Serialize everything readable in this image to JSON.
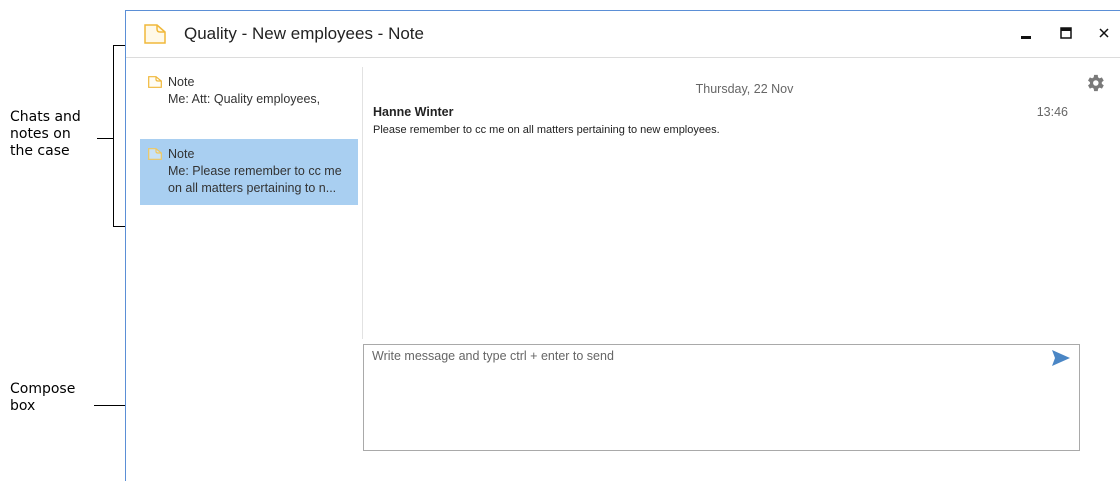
{
  "annotations": {
    "chats_label": "Chats and\nnotes on\nthe case",
    "compose_label": "Compose\nbox"
  },
  "window": {
    "title": "Quality - New employees - Note",
    "controls": {
      "minimize": "–",
      "maximize": "■",
      "close": "×"
    }
  },
  "conversations": [
    {
      "type": "Note",
      "preview": "Me: Att: Quality employees,",
      "selected": false
    },
    {
      "type": "Note",
      "preview": "Me: Please remember to cc me on all matters pertaining to n...",
      "selected": true
    }
  ],
  "conversation": {
    "date": "Thursday, 22 Nov",
    "messages": [
      {
        "sender": "Hanne Winter",
        "time": "13:46",
        "text": "Please remember to cc me on all matters pertaining to new employees."
      }
    ]
  },
  "compose": {
    "placeholder": "Write message and type ctrl + enter to send"
  },
  "icons": {
    "note": "note-icon",
    "settings": "gear-icon",
    "send": "send-icon"
  },
  "colors": {
    "selected_bg": "#a9cff1",
    "note_icon": "#f0b83a",
    "send_icon": "#4a86c5",
    "window_border": "#5b8fd6"
  }
}
